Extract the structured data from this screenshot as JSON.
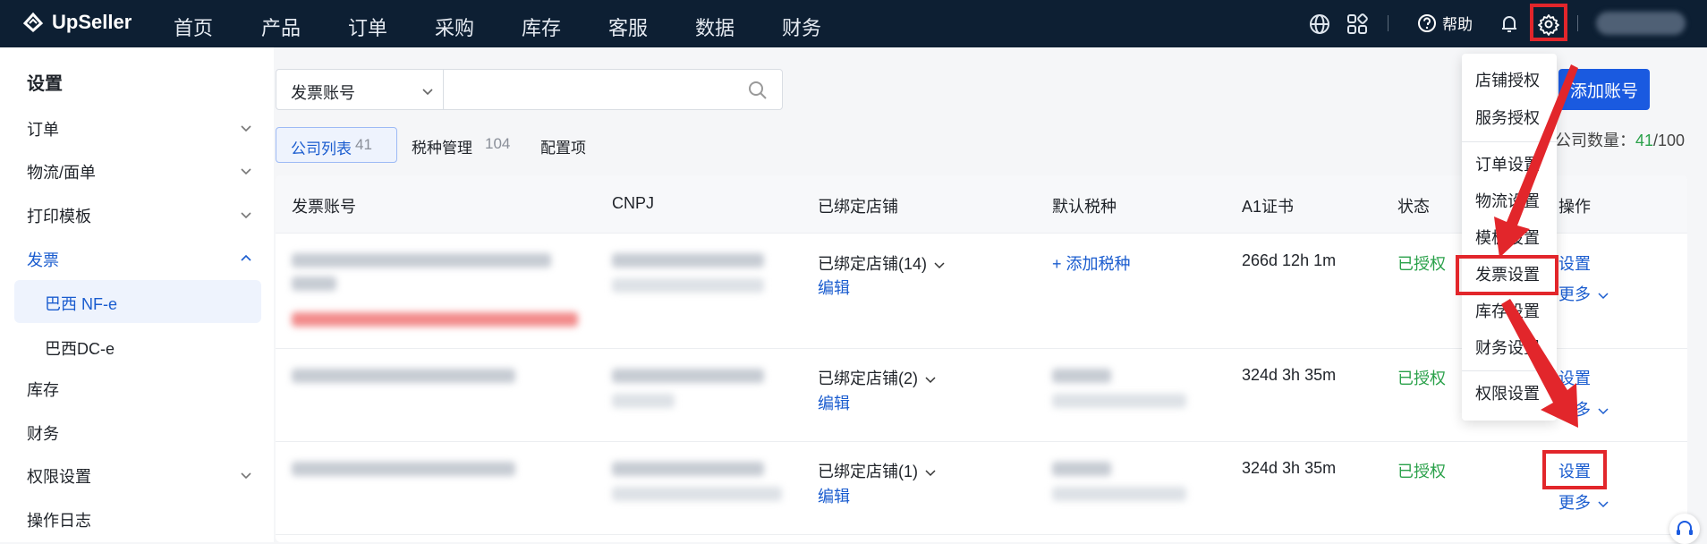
{
  "brand": "UpSeller",
  "nav": [
    "首页",
    "产品",
    "订单",
    "采购",
    "库存",
    "客服",
    "数据",
    "财务"
  ],
  "help_label": "帮助",
  "sidebar": {
    "title": "设置",
    "items": [
      {
        "label": "订单",
        "expandable": true
      },
      {
        "label": "物流/面单",
        "expandable": true
      },
      {
        "label": "打印模板",
        "expandable": true
      },
      {
        "label": "发票",
        "expandable": true,
        "expanded": true
      },
      {
        "label": "库存"
      },
      {
        "label": "财务"
      },
      {
        "label": "权限设置",
        "expandable": true
      },
      {
        "label": "操作日志"
      }
    ],
    "sub_items": [
      "巴西 NF-e",
      "巴西DC-e"
    ]
  },
  "search": {
    "field_select": "发票账号",
    "placeholder": ""
  },
  "tabs": [
    {
      "label": "公司列表",
      "count": "41"
    },
    {
      "label": "税种管理",
      "count": "104"
    },
    {
      "label": "配置项",
      "count": ""
    }
  ],
  "add_button": "添加账号",
  "company_count": {
    "label": "公司数量：",
    "used": "41",
    "total": "/100"
  },
  "table": {
    "headers": [
      "发票账号",
      "CNPJ",
      "已绑定店铺",
      "默认税种",
      "A1证书",
      "状态",
      "操作"
    ],
    "rows": [
      {
        "bound_shops": "已绑定店铺(14)",
        "edit": "编辑",
        "tax": "+ 添加税种",
        "cert": "266d 12h 1m",
        "status": "已授权",
        "action": "设置",
        "more": "更多"
      },
      {
        "bound_shops": "已绑定店铺(2)",
        "edit": "编辑",
        "tax": "",
        "cert": "324d 3h 35m",
        "status": "已授权",
        "action": "设置",
        "more": "更多"
      },
      {
        "bound_shops": "已绑定店铺(1)",
        "edit": "编辑",
        "tax": "",
        "cert": "324d 3h 35m",
        "status": "已授权",
        "action": "设置",
        "more": "更多"
      }
    ]
  },
  "settings_menu": [
    "店铺授权",
    "服务授权",
    "订单设置",
    "物流设置",
    "模板设置",
    "发票设置",
    "库存设置",
    "财务设置",
    "权限设置"
  ],
  "colors": {
    "nav_bg": "#0d1f33",
    "accent": "#1a5ae0",
    "highlight": "#e2262b",
    "success": "#2aa14a"
  }
}
